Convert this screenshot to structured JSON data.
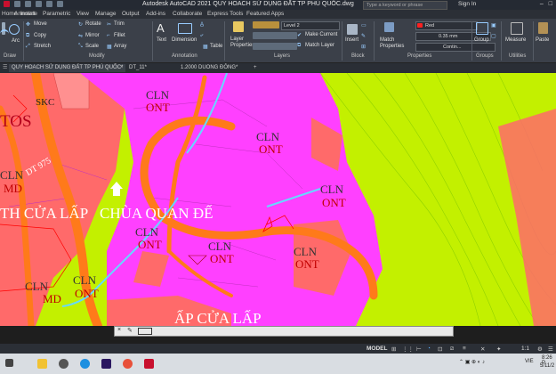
{
  "titlebar": {
    "title": "Autodesk AutoCAD 2021    QUY HOACH SỬ DỤNG ĐẤT TP PHÚ QUỐC.dwg",
    "search_placeholder": "Type a keyword or phrase",
    "signin": "Sign In"
  },
  "menu": {
    "tabs": [
      "Home",
      "Insert",
      "Annotate",
      "Parametric",
      "View",
      "Manage",
      "Output",
      "Add-ins",
      "Collaborate",
      "Express Tools",
      "Featured Apps"
    ]
  },
  "ribbon": {
    "draw": {
      "line": "Line",
      "polyline": "Polyline",
      "circle": "Circle",
      "arc": "Arc",
      "label": "Draw"
    },
    "modify": {
      "move": "Move",
      "rotate": "Rotate",
      "trim": "Trim",
      "copy": "Copy",
      "mirror": "Mirror",
      "fillet": "Fillet",
      "stretch": "Stretch",
      "scale": "Scale",
      "array": "Array",
      "label": "Modify"
    },
    "annotation": {
      "text": "Text",
      "dimension": "Dimension",
      "table": "Table",
      "label": "Annotation"
    },
    "layers": {
      "layer_properties": "Layer\nProperties",
      "current_layer": "Level 2",
      "make_current": "Make Current",
      "match_layer": "Match Layer",
      "label": "Layers"
    },
    "block": {
      "insert": "Insert",
      "label": "Block"
    },
    "properties": {
      "match_properties": "Match\nProperties",
      "color": "Red",
      "lineweight": "0.35 mm",
      "linetype": "Contin...",
      "label": "Properties"
    },
    "groups": {
      "group": "Group",
      "label": "Groups"
    },
    "utilities": {
      "measure": "Measure",
      "label": "Utilities"
    },
    "clipboard": {
      "paste": "Paste"
    }
  },
  "doc_tabs": [
    {
      "label": "QUY HOACH SỬ DỤNG ĐẤT TP PHÚ QUỐC*",
      "active": true
    },
    {
      "label": "DT_11*",
      "active": false
    },
    {
      "label": "1.2000 DUONG ĐÔNG*",
      "active": false
    }
  ],
  "drawing": {
    "labels": [
      {
        "top": "SKC",
        "bottom": ""
      },
      {
        "top": "CLN",
        "bottom": "ONT"
      },
      {
        "top": "CLN",
        "bottom": "ONT"
      },
      {
        "top": "CLN",
        "bottom": "ONT"
      },
      {
        "top": "CLN",
        "bottom": "ONT"
      },
      {
        "top": "CLN",
        "bottom": "ONT"
      },
      {
        "top": "CLN",
        "bottom": "ONT"
      },
      {
        "top": "CLN",
        "bottom": "ONT"
      },
      {
        "top": "CLN",
        "bottom": "MD"
      },
      {
        "top": "CLN",
        "bottom": "MD"
      }
    ],
    "place_names": [
      "TH CỬA LẤP",
      "CHÙA QUAN ĐẾ",
      "ẤP CỬA LẤP",
      "TOS"
    ],
    "road_label": "DT 975"
  },
  "command_line": {
    "prefix": "×"
  },
  "statusbar": {
    "model": "MODEL",
    "scale": "1:1"
  },
  "taskbar": {
    "time": "8:26 P",
    "date": "5/11/2",
    "lang": "VIE"
  },
  "colors": {
    "pink": "#ff40ff",
    "salmon": "#ff6a6a",
    "lime": "#c3f000",
    "road_orange": "#ff7a1a"
  }
}
